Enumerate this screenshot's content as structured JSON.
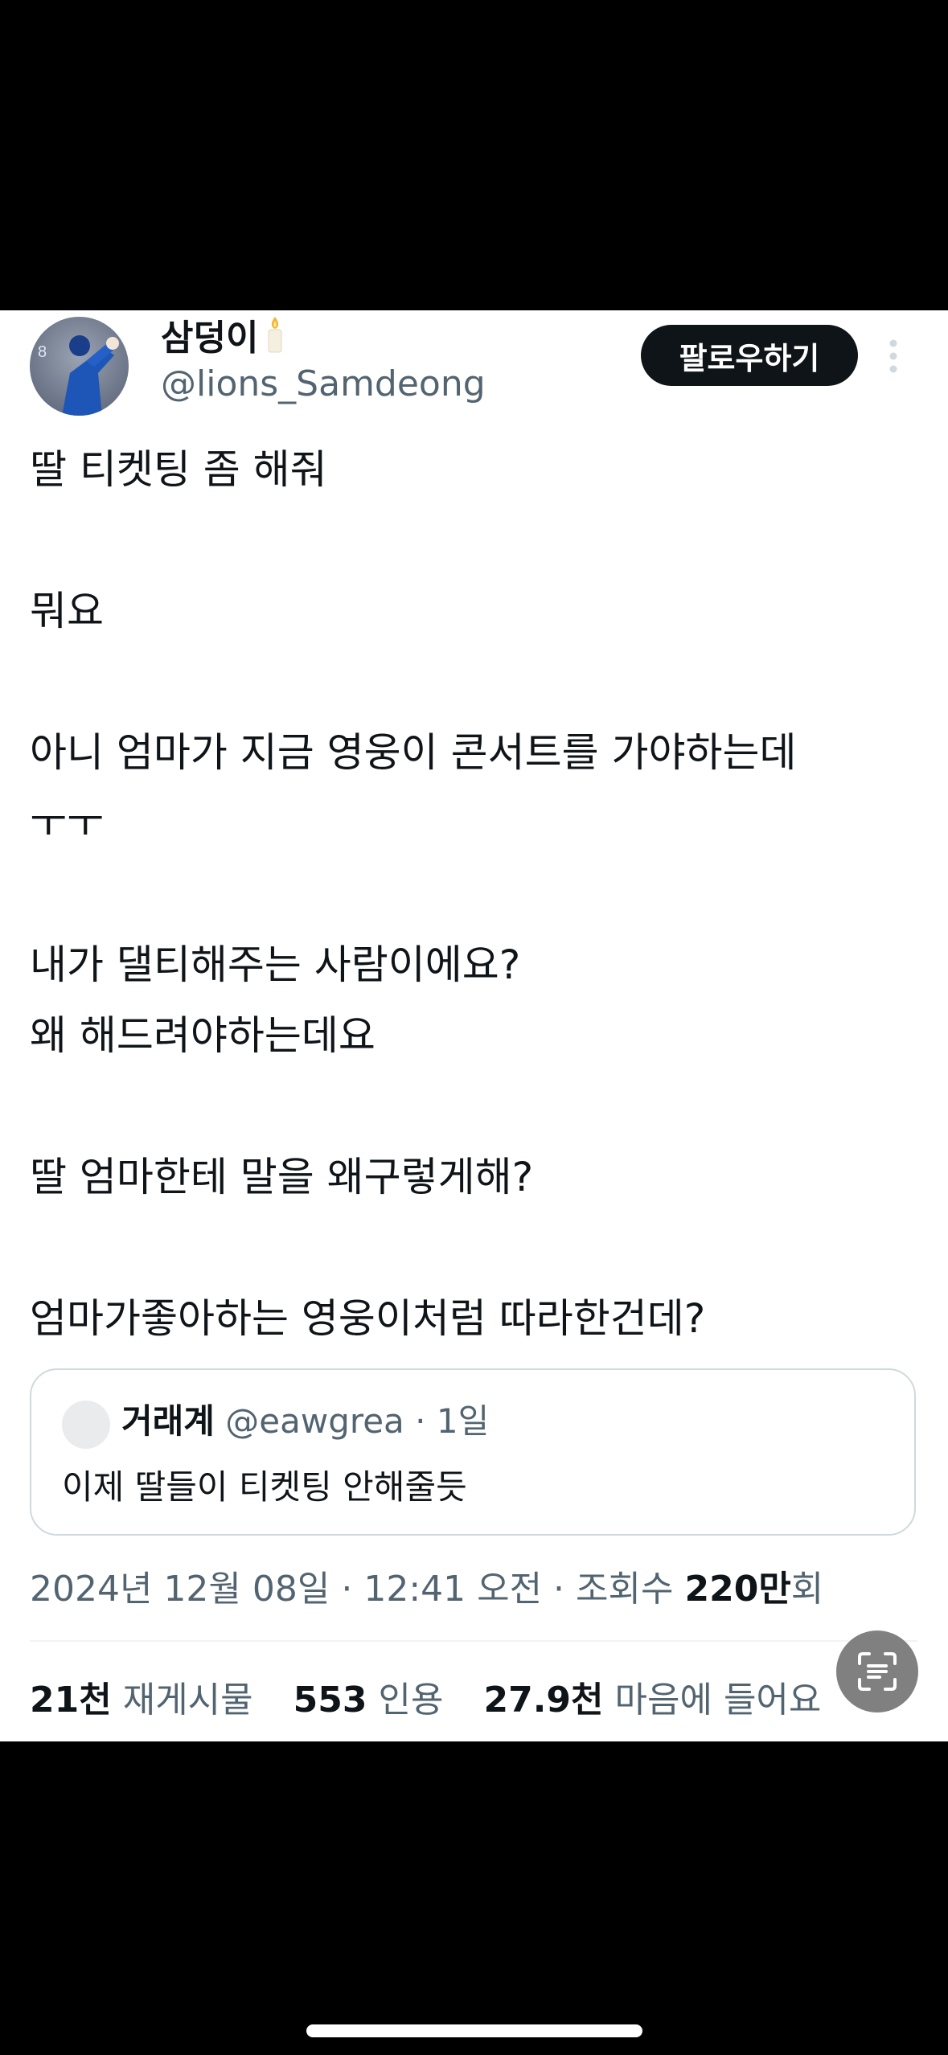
{
  "profile": {
    "display_name": "삼덩이",
    "handle": "@lions_Samdeong",
    "avatar_icon": "baseball-pitcher-avatar",
    "name_emoji_icon": "candle-icon"
  },
  "actions": {
    "follow_label": "팔로우하기",
    "more_icon": "more-vertical-icon"
  },
  "post": {
    "lines": [
      "딸 티켓팅 좀 해줘",
      "",
      "뭐요",
      "",
      "아니 엄마가 지금 영웅이 콘서트를 가야하는데",
      "ㅜㅜ",
      "",
      "내가 댈티해주는 사람이에요?",
      "왜 해드려야하는데요",
      "",
      "딸 엄마한테 말을 왜구렇게해?",
      "",
      "엄마가좋아하는 영웅이처럼 따라한건데?"
    ]
  },
  "quote": {
    "name": "거래계",
    "handle": "@eawgrea",
    "age": "· 1일",
    "text": "이제 딸들이 티켓팅 안해줄듯"
  },
  "meta": {
    "timestamp": "2024년 12월 08일 · 12:41 오전 · 조회수 ",
    "views_num": "220만",
    "views_unit": "회"
  },
  "stats": {
    "reposts_num": "21천",
    "reposts_label": "재게시물",
    "quotes_num": "553",
    "quotes_label": "인용",
    "likes_num": "27.9천",
    "likes_label": "마음에 들어요"
  },
  "colors": {
    "text_primary": "#0f1419",
    "text_secondary": "#536471",
    "border": "#cfd9de",
    "follow_bg": "#0f1419"
  }
}
